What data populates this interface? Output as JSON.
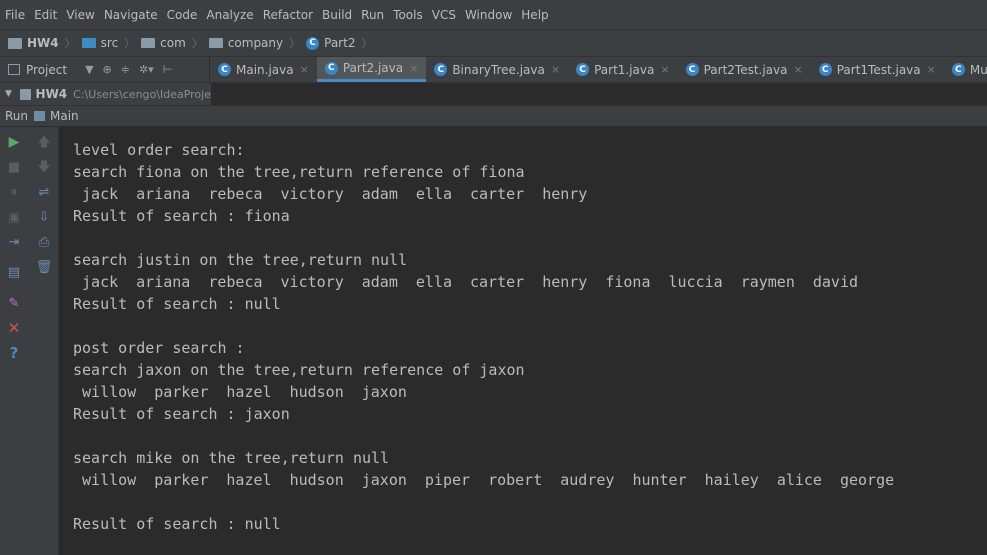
{
  "menu": [
    "File",
    "Edit",
    "View",
    "Navigate",
    "Code",
    "Analyze",
    "Refactor",
    "Build",
    "Run",
    "Tools",
    "VCS",
    "Window",
    "Help"
  ],
  "breadcrumb": {
    "project": "HW4",
    "src": "src",
    "com": "com",
    "company": "company",
    "cls": "Part2"
  },
  "project_panel": {
    "label": "Project"
  },
  "tabs": [
    {
      "label": "Main.java",
      "active": false
    },
    {
      "label": "Part2.java",
      "active": true
    },
    {
      "label": "BinaryTree.java",
      "active": false
    },
    {
      "label": "Part1.java",
      "active": false
    },
    {
      "label": "Part2Test.java",
      "active": false
    },
    {
      "label": "Part1Test.java",
      "active": false
    },
    {
      "label": "MustBeComp",
      "active": false
    }
  ],
  "project_tree": {
    "name": "HW4",
    "path": "C:\\Users\\cengo\\IdeaProje"
  },
  "run": {
    "label": "Run",
    "config": "Main"
  },
  "console": {
    "l1": "level order search:",
    "l2": "search fiona on the tree,return reference of fiona",
    "w3": [
      "jack",
      "ariana",
      "rebeca",
      "victory",
      "adam",
      "ella",
      "carter",
      "henry"
    ],
    "l4": "Result of search : fiona",
    "l6": "search justin on the tree,return null",
    "w7": [
      "jack",
      "ariana",
      "rebeca",
      "victory",
      "adam",
      "ella",
      "carter",
      "henry",
      "fiona",
      "luccia",
      "raymen",
      "david"
    ],
    "l8": "Result of search : null",
    "l10": "post order search :",
    "l11": "search jaxon on the tree,return reference of jaxon",
    "w12": [
      "willow",
      "parker",
      "hazel",
      "hudson",
      "jaxon"
    ],
    "l13": "Result of search : jaxon",
    "l15": "search mike on the tree,return null",
    "w16": [
      "willow",
      "parker",
      "hazel",
      "hudson",
      "jaxon",
      "piper",
      "robert",
      "audrey",
      "hunter",
      "hailey",
      "alice",
      "george"
    ],
    "l18": "Result of search : null"
  }
}
